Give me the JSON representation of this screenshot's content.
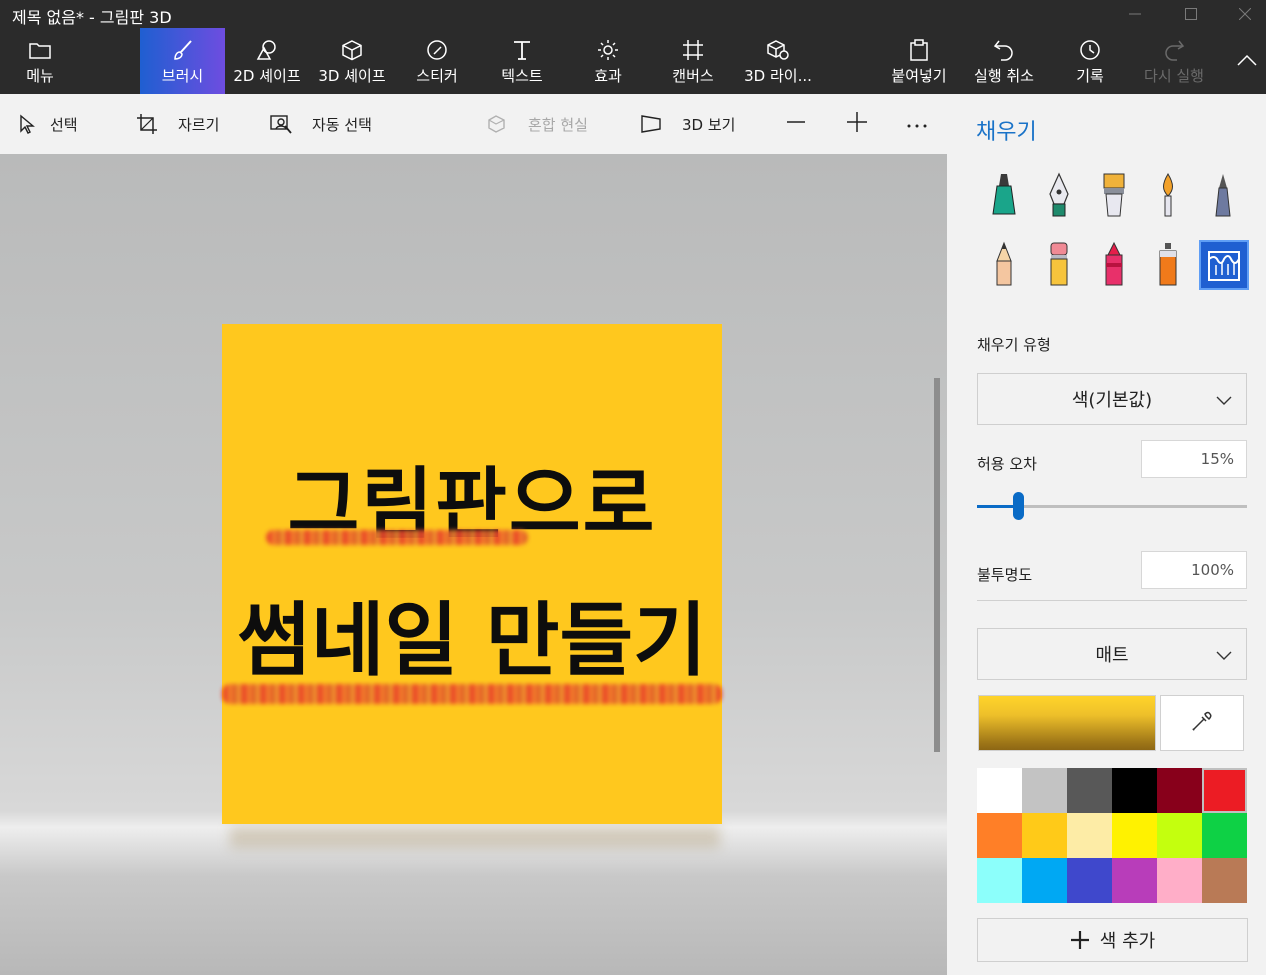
{
  "window": {
    "title": "제목 없음* - 그림판 3D"
  },
  "ribbon": {
    "items": [
      {
        "label": "메뉴",
        "icon": "folder-icon"
      },
      {
        "label": "브러시",
        "icon": "brush-icon",
        "active": true
      },
      {
        "label": "2D 셰이프",
        "icon": "2d-shapes-icon"
      },
      {
        "label": "3D 셰이프",
        "icon": "3d-cube-icon"
      },
      {
        "label": "스티커",
        "icon": "sticker-icon"
      },
      {
        "label": "텍스트",
        "icon": "text-icon"
      },
      {
        "label": "효과",
        "icon": "sun-icon"
      },
      {
        "label": "캔버스",
        "icon": "canvas-icon"
      },
      {
        "label": "3D 라이...",
        "icon": "3d-library-icon"
      },
      {
        "label": "붙여넣기",
        "icon": "paste-icon"
      },
      {
        "label": "실행 취소",
        "icon": "undo-icon"
      },
      {
        "label": "기록",
        "icon": "history-icon"
      },
      {
        "label": "다시 실행",
        "icon": "redo-icon",
        "disabled": true
      }
    ]
  },
  "toolbar": {
    "select": "선택",
    "crop": "자르기",
    "magic_select": "자동 선택",
    "mixed_reality": "혼합 현실",
    "view_3d": "3D 보기"
  },
  "canvas": {
    "line1": "그림판으로",
    "line2": "썸네일 만들기",
    "background": "#ffc81e"
  },
  "panel": {
    "title": "채우기",
    "brushes": [
      "marker-icon",
      "calligraphy-pen-icon",
      "oil-brush-icon",
      "watercolor-icon",
      "pixel-pen-icon",
      "pencil-icon",
      "eraser-icon",
      "crayon-icon",
      "spray-can-icon",
      "fill-bucket-icon"
    ],
    "fill_type_label": "채우기 유형",
    "fill_type_value": "색(기본값)",
    "tolerance_label": "허용 오차",
    "tolerance_value": "15%",
    "tolerance_fraction": 0.15,
    "opacity_label": "불투명도",
    "opacity_value": "100%",
    "material_value": "매트",
    "add_color_label": "색 추가",
    "palette": [
      "#ffffff",
      "#c3c3c3",
      "#585858",
      "#000000",
      "#88001b",
      "#ec1c24",
      "#ff7f27",
      "#ffca18",
      "#fdeca6",
      "#fff200",
      "#c4ff0e",
      "#0ed145",
      "#8cfffb",
      "#00a8f3",
      "#3f48cc",
      "#b83dba",
      "#ffaec8",
      "#b97a56"
    ]
  }
}
